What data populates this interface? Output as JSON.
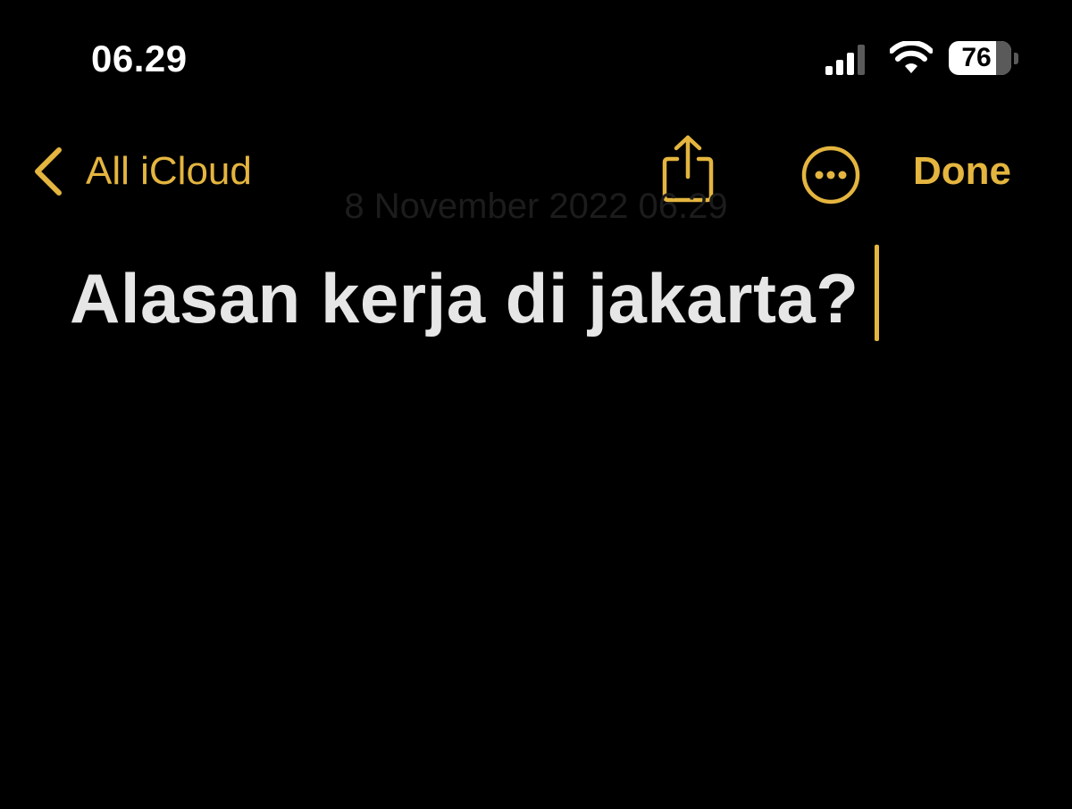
{
  "status_bar": {
    "time": "06.29",
    "battery_level": "76",
    "battery_fraction": 0.76,
    "signal_bars_active": 3,
    "signal_bars_total": 4
  },
  "nav": {
    "back_label": "All iCloud",
    "done_label": "Done",
    "icons": [
      "chevron-left-icon",
      "share-icon",
      "more-ellipsis-icon"
    ]
  },
  "note": {
    "date": "8 November 2022 06.29",
    "title": "Alasan kerja di jakarta?"
  },
  "colors": {
    "accent": "#e4b53f",
    "background": "#000000",
    "text": "#e6e6e6"
  }
}
